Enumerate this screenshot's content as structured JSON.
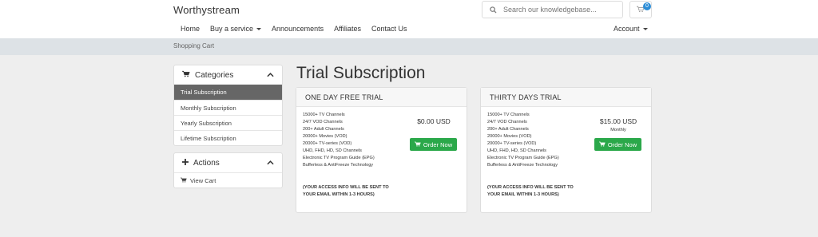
{
  "header": {
    "brand": "Worthystream",
    "search_placeholder": "Search our knowledgebase...",
    "cart_count": "0"
  },
  "nav": {
    "items": [
      {
        "label": "Home"
      },
      {
        "label": "Buy a service"
      },
      {
        "label": "Announcements"
      },
      {
        "label": "Affiliates"
      },
      {
        "label": "Contact Us"
      }
    ],
    "account_label": "Account"
  },
  "breadcrumb": "Shopping Cart",
  "sidebar": {
    "categories_title": "Categories",
    "categories": [
      {
        "label": "Trial Subscription",
        "active": true
      },
      {
        "label": "Monthly Subscription"
      },
      {
        "label": "Yearly Subscription"
      },
      {
        "label": "Lifetime Subscription"
      }
    ],
    "actions_title": "Actions",
    "actions": [
      {
        "label": "View Cart"
      }
    ]
  },
  "main": {
    "title": "Trial Subscription",
    "products": [
      {
        "name": "ONE DAY FREE TRIAL",
        "features": [
          "15000+ TV Channels",
          "24/7 VOD Channels",
          "200+ Adult Channels",
          "20000+ Movies (VOD)",
          "20000+ TV-series (VOD)",
          "UHD, FHD, HD, SD Channels",
          "Electronic TV Program Guide (EPG)",
          "Bufferless & AntiFreeze Technology"
        ],
        "notice_line1": "(YOUR ACCESS INFO WILL BE SENT TO",
        "notice_line2": "YOUR EMAIL WITHIN 1-3 HOURS)",
        "price": "$0.00 USD",
        "cycle": "",
        "order_label": "Order Now"
      },
      {
        "name": "THIRTY DAYS TRIAL",
        "features": [
          "15000+ TV Channels",
          "24/7 VOD Channels",
          "200+ Adult Channels",
          "20000+ Movies (VOD)",
          "20000+ TV-series (VOD)",
          "UHD, FHD, HD, SD Channels",
          "Electronic TV Program Guide (EPG)",
          "Bufferless & AntiFreeze Technology"
        ],
        "notice_line1": "(YOUR ACCESS INFO WILL BE SENT TO",
        "notice_line2": "YOUR EMAIL WITHIN 1-3 HOURS)",
        "price": "$15.00 USD",
        "cycle": "Monthly",
        "order_label": "Order Now"
      }
    ]
  },
  "colors": {
    "accent_green": "#2ba84a",
    "badge_blue": "#2d8dd6",
    "active_item": "#666666"
  }
}
